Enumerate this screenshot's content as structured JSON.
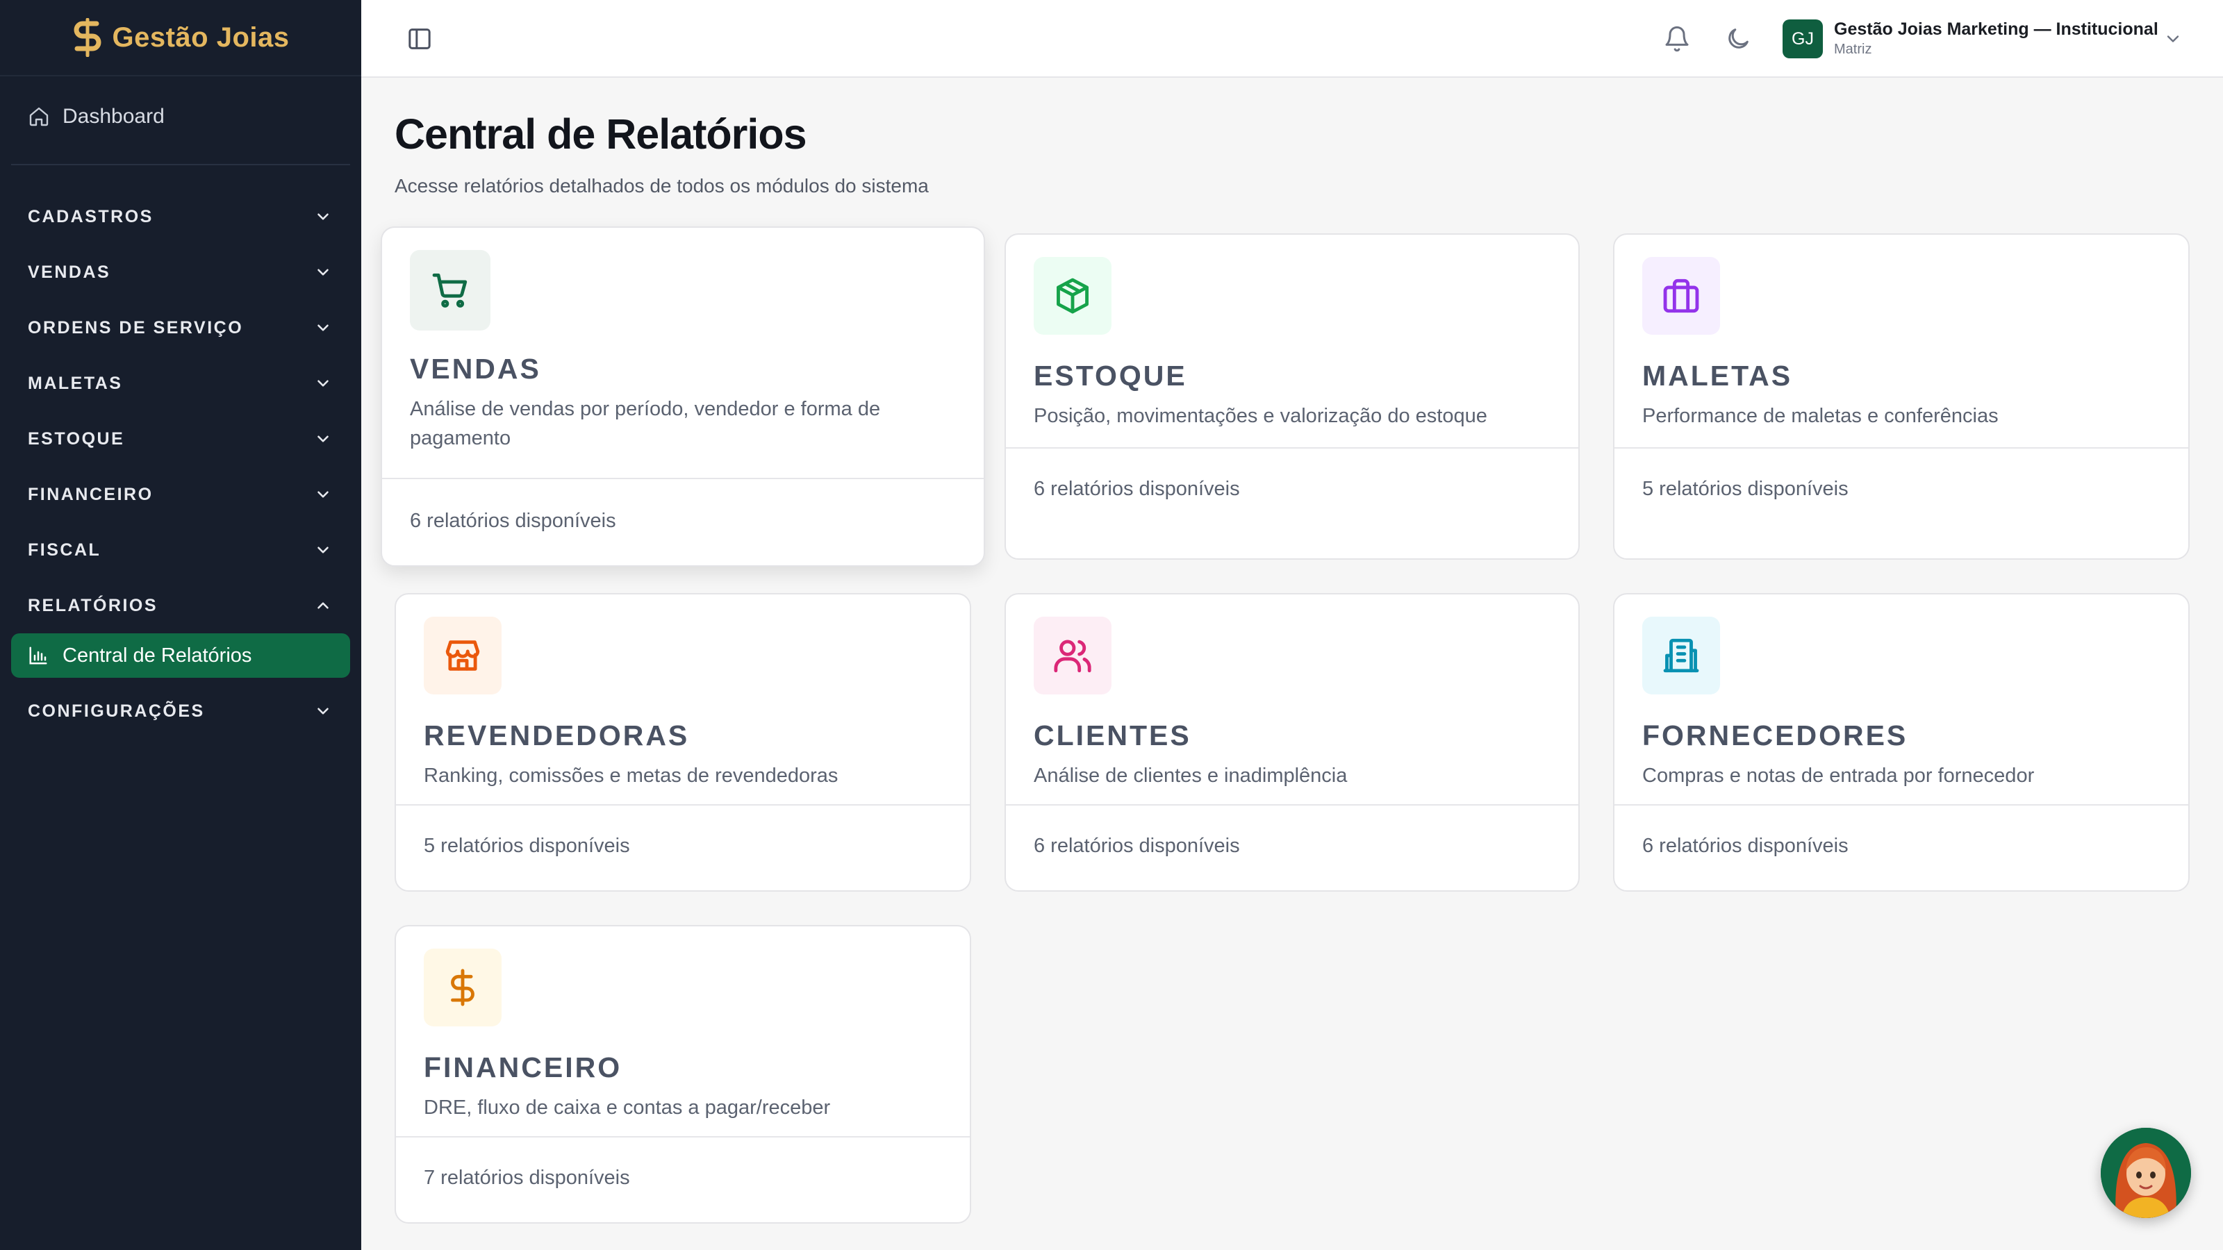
{
  "brand": {
    "name": "Gestão Joias",
    "color": "#e4b75f"
  },
  "sidebar": {
    "dashboard": "Dashboard",
    "sections": [
      {
        "label": "CADASTROS",
        "expanded": false
      },
      {
        "label": "VENDAS",
        "expanded": false
      },
      {
        "label": "ORDENS DE SERVIÇO",
        "expanded": false
      },
      {
        "label": "MALETAS",
        "expanded": false
      },
      {
        "label": "ESTOQUE",
        "expanded": false
      },
      {
        "label": "FINANCEIRO",
        "expanded": false
      },
      {
        "label": "FISCAL",
        "expanded": false
      },
      {
        "label": "RELATÓRIOS",
        "expanded": true
      },
      {
        "label": "CONFIGURAÇÕES",
        "expanded": false
      }
    ],
    "active_item": "Central de Relatórios",
    "active_color": "#0f6b45"
  },
  "header": {
    "avatar_initials": "GJ",
    "org_name": "Gestão Joias Marketing — Institucional",
    "org_sub": "Matriz",
    "icons": [
      "sidebar-toggle-icon",
      "bell-icon",
      "moon-icon",
      "chevron-down-icon"
    ]
  },
  "page": {
    "title": "Central de Relatórios",
    "subtitle": "Acesse relatórios detalhados de todos os módulos do sistema"
  },
  "cards": [
    {
      "title": "VENDAS",
      "desc": "Análise de vendas por período, vendedor e forma de pagamento",
      "count": "6 relatórios disponíveis",
      "icon": "shopping-cart-icon",
      "icon_color": "#0f6b45",
      "icon_bg": "#eef3f0"
    },
    {
      "title": "ESTOQUE",
      "desc": "Posição, movimentações e valorização do estoque",
      "count": "6 relatórios disponíveis",
      "icon": "package-icon",
      "icon_color": "#16a34a",
      "icon_bg": "#ecfdf3"
    },
    {
      "title": "MALETAS",
      "desc": "Performance de maletas e conferências",
      "count": "5 relatórios disponíveis",
      "icon": "briefcase-icon",
      "icon_color": "#9333ea",
      "icon_bg": "#f6efff"
    },
    {
      "title": "REVENDEDORAS",
      "desc": "Ranking, comissões e metas de revendedoras",
      "count": "5 relatórios disponíveis",
      "icon": "store-icon",
      "icon_color": "#ea580c",
      "icon_bg": "#fff3e9"
    },
    {
      "title": "CLIENTES",
      "desc": "Análise de clientes e inadimplência",
      "count": "6 relatórios disponíveis",
      "icon": "users-icon",
      "icon_color": "#db2777",
      "icon_bg": "#fdeef5"
    },
    {
      "title": "FORNECEDORES",
      "desc": "Compras e notas de entrada por fornecedor",
      "count": "6 relatórios disponíveis",
      "icon": "building-icon",
      "icon_color": "#0891b2",
      "icon_bg": "#e8f8fc"
    },
    {
      "title": "FINANCEIRO",
      "desc": "DRE, fluxo de caixa e contas a pagar/receber",
      "count": "7 relatórios disponíveis",
      "icon": "dollar-icon",
      "icon_color": "#d97706",
      "icon_bg": "#fff8e6"
    }
  ]
}
